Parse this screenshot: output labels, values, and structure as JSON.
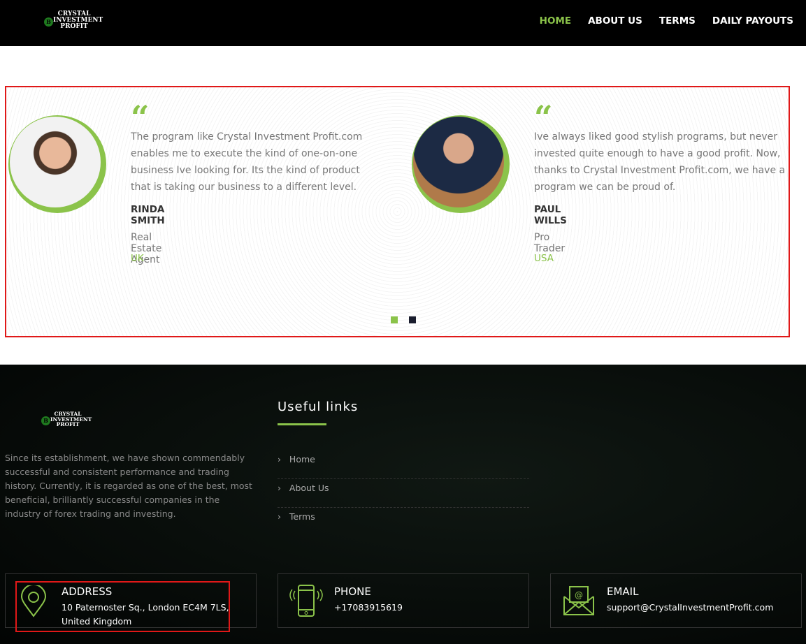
{
  "nav": {
    "logo": "CRYSTAL INVESTMENT PROFIT",
    "items": [
      {
        "label": "HOME"
      },
      {
        "label": "ABOUT US"
      },
      {
        "label": "TERMS"
      },
      {
        "label": "DAILY PAYOUTS"
      }
    ]
  },
  "testimonials": [
    {
      "text": "The program like Crystal Investment Profit.com enables me to execute the kind of one-on-one business Ive looking for. Its the kind of product that is taking our business to a different level.",
      "name": "RINDA SMITH",
      "role": "Real Estate Agent",
      "country": "UK"
    },
    {
      "text": "Ive always liked good stylish programs, but never invested quite enough to have a good profit. Now, thanks to Crystal Investment Profit.com, we have a program we can be proud of.",
      "name": "PAUL WILLS",
      "role": "Pro Trader",
      "country": "USA"
    }
  ],
  "footer": {
    "about": "Since its establishment, we have shown commendably successful and consistent performance and trading history. Currently, it is regarded as one of the best, most beneficial, brilliantly successful companies in the industry of forex trading and investing.",
    "useful_title": "Useful links",
    "links": [
      {
        "label": "Home"
      },
      {
        "label": "About Us"
      },
      {
        "label": "Terms"
      }
    ],
    "address": {
      "title": "ADDRESS",
      "value": "10 Paternoster Sq., London EC4M 7LS, United Kingdom"
    },
    "phone": {
      "title": "PHONE",
      "value": "+17083915619"
    },
    "email": {
      "title": "EMAIL",
      "value": "support@CrystalInvestmentProfit.com"
    }
  },
  "colors": {
    "accent": "#8bc34a"
  }
}
